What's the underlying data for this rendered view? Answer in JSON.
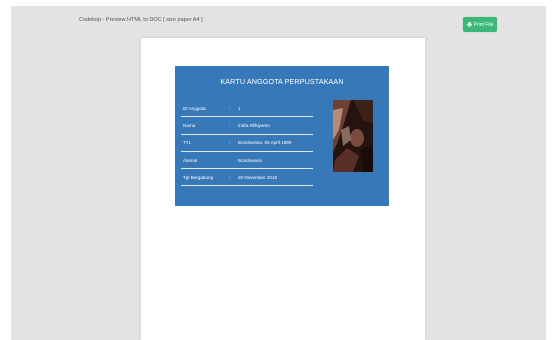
{
  "viewer": {
    "title": "Codekop - Preview HTML to DOC [ size paper A4 ]",
    "print_button_label": "Print File",
    "print_icon": "printer-icon"
  },
  "card": {
    "title": "KARTU ANGGOTA PERPUSTAKAAN",
    "separator": ":",
    "fields": [
      {
        "label": "ID Anggota",
        "value": "1"
      },
      {
        "label": "Nama",
        "value": "Indra Rifkiyanto"
      },
      {
        "label": "TTL",
        "value": "Bondowoso, 05 April 1999"
      },
      {
        "label": "Alamat",
        "value": "Bondowoso"
      },
      {
        "label": "Tgl Bergabung",
        "value": "20 November 2019"
      }
    ]
  },
  "colors": {
    "card_background": "#3778b9",
    "print_button": "#3cb878",
    "viewer_background": "#e3e3e3"
  }
}
